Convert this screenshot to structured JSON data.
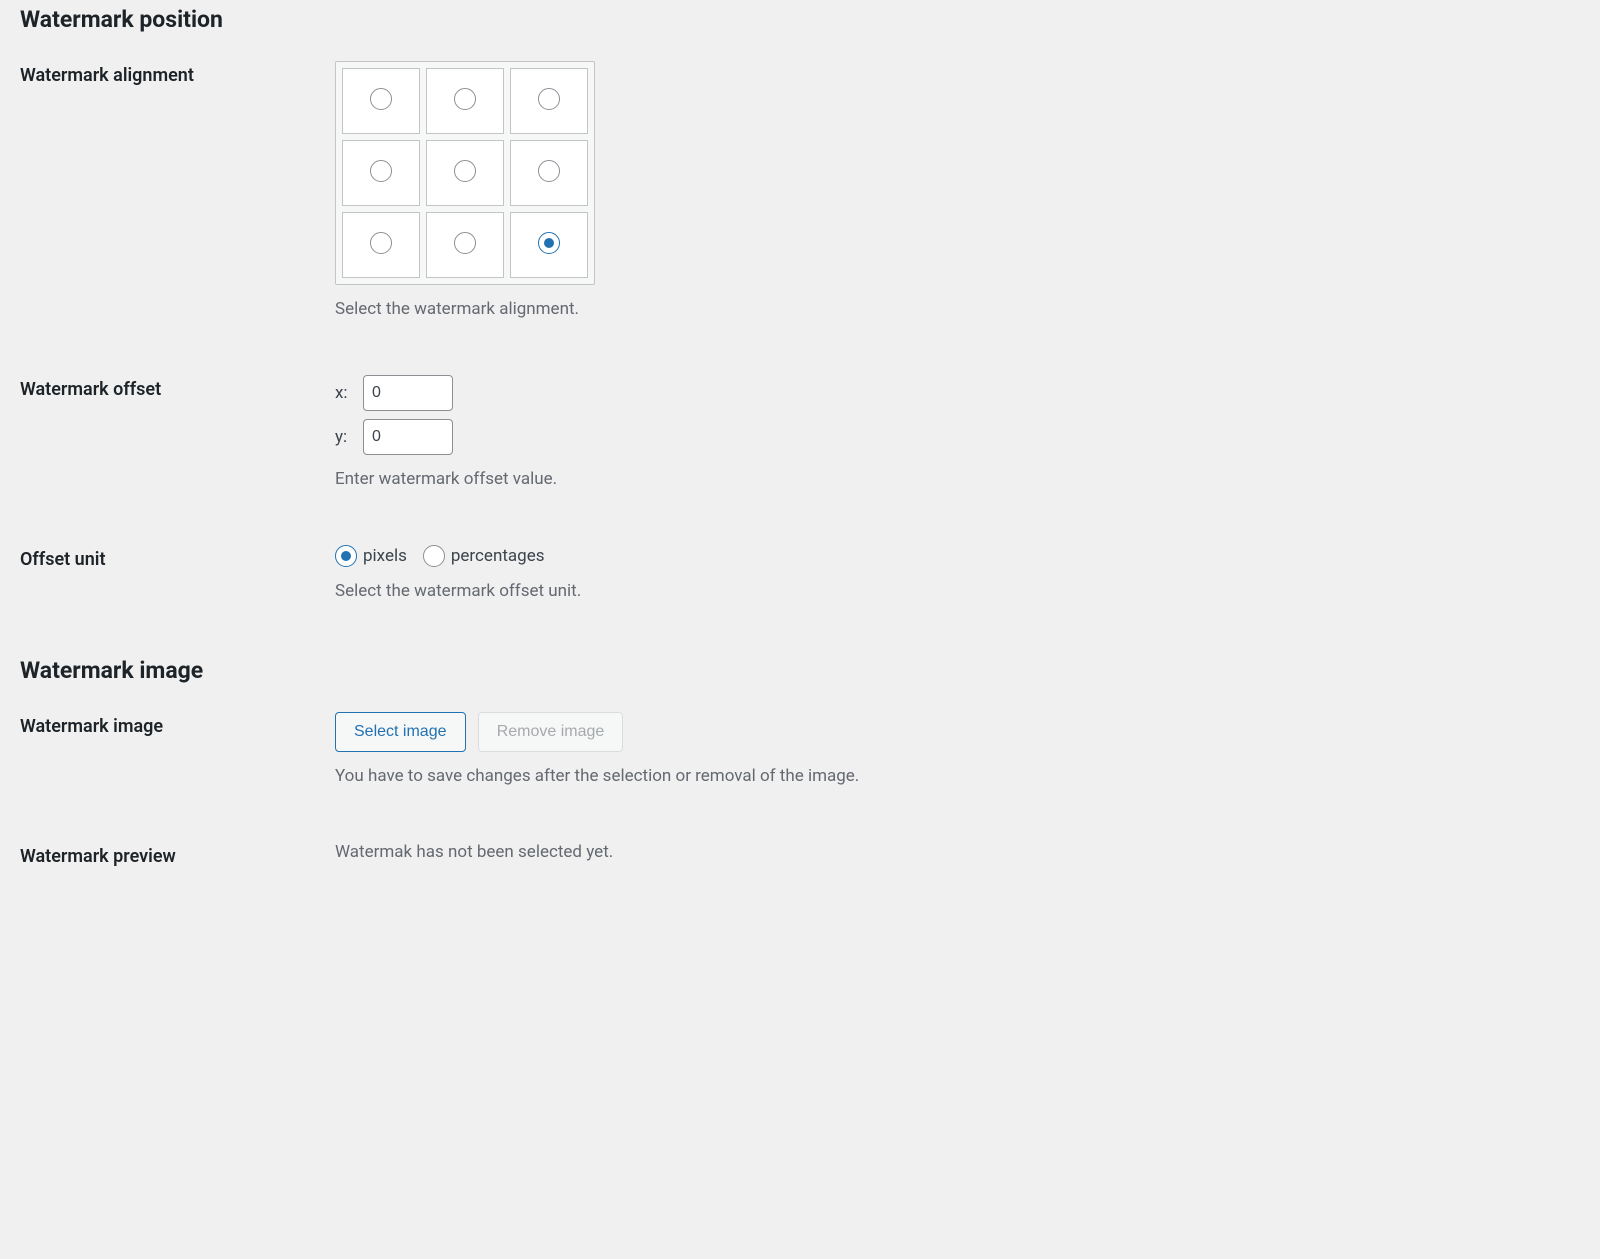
{
  "sections": {
    "position_title": "Watermark position",
    "image_title": "Watermark image"
  },
  "alignment": {
    "label": "Watermark alignment",
    "description": "Select the watermark alignment.",
    "selected_index": 8
  },
  "offset": {
    "label": "Watermark offset",
    "x_label": "x:",
    "y_label": "y:",
    "x_value": "0",
    "y_value": "0",
    "description": "Enter watermark offset value."
  },
  "offset_unit": {
    "label": "Offset unit",
    "option_pixels": "pixels",
    "option_percentages": "percentages",
    "selected": "pixels",
    "description": "Select the watermark offset unit."
  },
  "image": {
    "label": "Watermark image",
    "select_button": "Select image",
    "remove_button": "Remove image",
    "description": "You have to save changes after the selection or removal of the image."
  },
  "preview": {
    "label": "Watermark preview",
    "text": "Watermak has not been selected yet."
  }
}
